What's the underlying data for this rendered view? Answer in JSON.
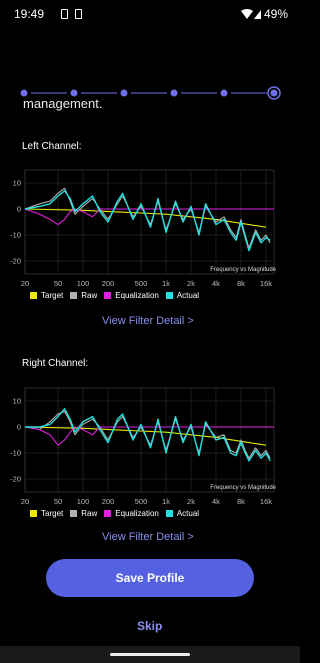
{
  "status_bar": {
    "time": "19:49",
    "battery": "49%"
  },
  "stepper": {
    "steps": 6,
    "active_index": 5,
    "color": "#6d70e6"
  },
  "intro_text": "management.",
  "left_channel": {
    "label": "Left Channel:",
    "view_detail_label": "View Filter Detail >",
    "chart_data": {
      "type": "line",
      "title": "Frequency vs Magnitude",
      "x_scale": "log",
      "xlim": [
        20,
        20000
      ],
      "x_ticks": [
        "20",
        "50",
        "100",
        "200",
        "500",
        "1k",
        "2k",
        "4k",
        "8k",
        "16k"
      ],
      "ylim": [
        -25,
        15
      ],
      "y_ticks": [
        10,
        0,
        -10,
        -20
      ],
      "grid": true,
      "legend_position": "bottom",
      "series": [
        {
          "name": "Target",
          "color": "#e8e800",
          "x": [
            20,
            100,
            1000,
            4000,
            10000,
            16000
          ],
          "y": [
            0,
            -0.5,
            -2,
            -4,
            -6,
            -7
          ]
        },
        {
          "name": "Raw",
          "color": "#b0b0b0",
          "x": [
            20,
            30,
            40,
            50,
            60,
            70,
            80,
            100,
            130,
            160,
            200,
            260,
            300,
            400,
            500,
            650,
            800,
            1000,
            1300,
            1600,
            2000,
            2500,
            3000,
            4000,
            5000,
            6000,
            7000,
            8000,
            9000,
            10000,
            12000,
            14000,
            16000,
            18000
          ],
          "y": [
            0,
            2,
            3,
            6,
            8,
            3,
            -2,
            1,
            4,
            0,
            -4,
            2,
            5,
            -3,
            1,
            -6,
            3,
            -8,
            2,
            -4,
            0,
            -9,
            1,
            -5,
            -3,
            -8,
            -11,
            -4,
            -10,
            -15,
            -8,
            -12,
            -10,
            -13
          ]
        },
        {
          "name": "Equalization",
          "color": "#e020e0",
          "x": [
            20,
            30,
            40,
            50,
            60,
            70,
            80,
            100,
            130,
            160,
            200,
            300,
            20000
          ],
          "y": [
            0,
            -2,
            -4,
            -6,
            -4,
            -1,
            0,
            -1,
            -3,
            0,
            0,
            0,
            0
          ]
        },
        {
          "name": "Actual",
          "color": "#20e0e0",
          "x": [
            20,
            30,
            40,
            50,
            60,
            70,
            80,
            100,
            130,
            160,
            200,
            260,
            300,
            400,
            500,
            650,
            800,
            1000,
            1300,
            1600,
            2000,
            2500,
            3000,
            4000,
            5000,
            6000,
            7000,
            8000,
            9000,
            10000,
            12000,
            14000,
            16000,
            18000
          ],
          "y": [
            0,
            1,
            2,
            5,
            7,
            4,
            -1,
            2,
            5,
            -1,
            -5,
            3,
            6,
            -4,
            2,
            -7,
            4,
            -9,
            3,
            -5,
            1,
            -10,
            2,
            -6,
            -4,
            -9,
            -12,
            -5,
            -11,
            -16,
            -9,
            -13,
            -11,
            -12
          ]
        }
      ]
    }
  },
  "right_channel": {
    "label": "Right Channel:",
    "view_detail_label": "View Filter Detail >",
    "chart_data": {
      "type": "line",
      "title": "Frequency vs Magnitude",
      "x_scale": "log",
      "xlim": [
        20,
        20000
      ],
      "x_ticks": [
        "20",
        "50",
        "100",
        "200",
        "500",
        "1k",
        "2k",
        "4k",
        "8k",
        "16k"
      ],
      "ylim": [
        -25,
        15
      ],
      "y_ticks": [
        10,
        0,
        -10,
        -20
      ],
      "grid": true,
      "legend_position": "bottom",
      "series": [
        {
          "name": "Target",
          "color": "#e8e800",
          "x": [
            20,
            100,
            1000,
            4000,
            10000,
            16000
          ],
          "y": [
            0,
            -0.5,
            -2,
            -4,
            -6,
            -7
          ]
        },
        {
          "name": "Raw",
          "color": "#b0b0b0",
          "x": [
            20,
            30,
            40,
            50,
            60,
            70,
            80,
            100,
            130,
            160,
            200,
            260,
            300,
            400,
            500,
            650,
            800,
            1000,
            1300,
            1600,
            2000,
            2500,
            3000,
            4000,
            5000,
            6000,
            7000,
            8000,
            9000,
            10000,
            12000,
            14000,
            16000,
            18000
          ],
          "y": [
            0,
            -1,
            2,
            5,
            6,
            2,
            -3,
            1,
            3,
            0,
            -5,
            2,
            4,
            -4,
            0,
            -7,
            2,
            -9,
            3,
            -5,
            0,
            -10,
            1,
            -4,
            -3,
            -9,
            -10,
            -5,
            -9,
            -12,
            -8,
            -11,
            -9,
            -12
          ]
        },
        {
          "name": "Equalization",
          "color": "#e020e0",
          "x": [
            20,
            30,
            40,
            50,
            60,
            70,
            80,
            100,
            130,
            160,
            200,
            300,
            20000
          ],
          "y": [
            0,
            -1,
            -3,
            -7,
            -5,
            -2,
            0,
            -1,
            -3,
            0,
            0,
            0,
            0
          ]
        },
        {
          "name": "Actual",
          "color": "#20e0e0",
          "x": [
            20,
            30,
            40,
            50,
            60,
            70,
            80,
            100,
            130,
            160,
            200,
            260,
            300,
            400,
            500,
            650,
            800,
            1000,
            1300,
            1600,
            2000,
            2500,
            3000,
            4000,
            5000,
            6000,
            7000,
            8000,
            9000,
            10000,
            12000,
            14000,
            16000,
            18000
          ],
          "y": [
            0,
            0,
            1,
            4,
            7,
            3,
            -2,
            2,
            4,
            -1,
            -6,
            3,
            5,
            -5,
            1,
            -8,
            3,
            -10,
            4,
            -6,
            1,
            -11,
            2,
            -5,
            -4,
            -10,
            -11,
            -6,
            -10,
            -13,
            -9,
            -12,
            -10,
            -13
          ]
        }
      ]
    }
  },
  "actions": {
    "save_label": "Save Profile",
    "skip_label": "Skip"
  }
}
